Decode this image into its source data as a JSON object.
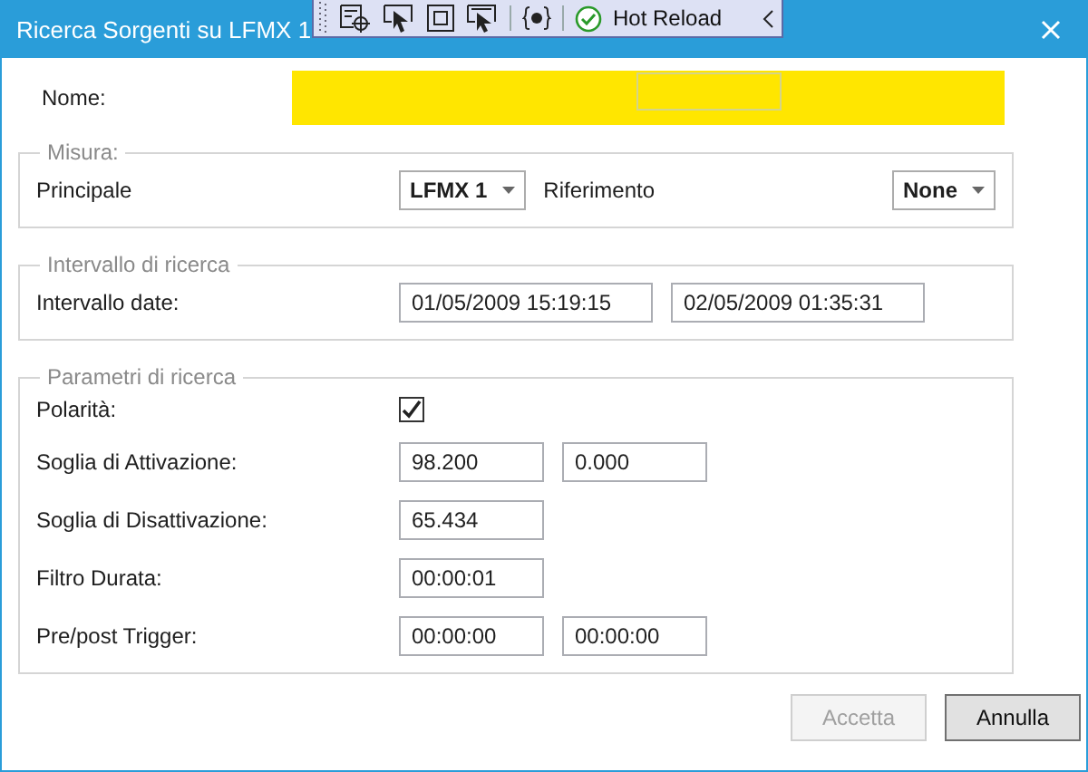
{
  "window": {
    "title": "Ricerca Sorgenti su LFMX 1"
  },
  "debug_toolbar": {
    "label": "Hot Reload"
  },
  "name": {
    "label": "Nome:",
    "highlighted": true
  },
  "groups": [
    {
      "title": "Misura:",
      "rows": [
        {
          "label": "Principale",
          "controls": [
            {
              "kind": "combo",
              "value": "LFMX 1"
            },
            {
              "kind": "label",
              "text": "Riferimento"
            },
            {
              "kind": "combo",
              "value": "None"
            }
          ]
        }
      ]
    },
    {
      "title": "Intervallo di ricerca",
      "rows": [
        {
          "label": "Intervallo date:",
          "controls": [
            {
              "kind": "datetime",
              "value": "01/05/2009 15:19:15"
            },
            {
              "kind": "datetime",
              "value": "02/05/2009 01:35:31"
            }
          ]
        }
      ]
    },
    {
      "title": "Parametri di ricerca",
      "rows": [
        {
          "label": "Polarità:",
          "controls": [
            {
              "kind": "checkbox",
              "checked": true
            }
          ]
        },
        {
          "label": "Soglia di Attivazione:",
          "controls": [
            {
              "kind": "text",
              "value": "98.200"
            },
            {
              "kind": "text",
              "value": "0.000"
            }
          ]
        },
        {
          "label": "Soglia di Disattivazione:",
          "controls": [
            {
              "kind": "text",
              "value": "65.434"
            }
          ]
        },
        {
          "label": "Filtro Durata:",
          "controls": [
            {
              "kind": "text",
              "value": "00:00:01"
            }
          ]
        },
        {
          "label": "Pre/post Trigger:",
          "controls": [
            {
              "kind": "text",
              "value": "00:00:00"
            },
            {
              "kind": "text",
              "value": "00:00:00"
            }
          ]
        }
      ]
    }
  ],
  "buttons": [
    {
      "label": "Accetta",
      "disabled": true
    },
    {
      "label": "Annulla",
      "disabled": false
    }
  ]
}
